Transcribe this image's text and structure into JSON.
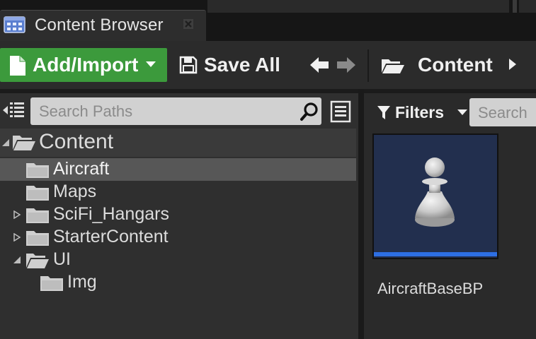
{
  "tab": {
    "title": "Content Browser",
    "icon": "content-browser-icon",
    "close_icon": "close-icon"
  },
  "toolbar": {
    "add_import_label": "Add/Import",
    "save_all_label": "Save All",
    "breadcrumb_root": "Content",
    "accent_green": "#3c9a3c"
  },
  "sources": {
    "search_placeholder": "Search Paths",
    "tree": [
      {
        "label": "Content",
        "expanded": true,
        "level": 0,
        "selected": false
      },
      {
        "label": "Aircraft",
        "expanded": false,
        "level": 1,
        "selected": true
      },
      {
        "label": "Maps",
        "expanded": false,
        "level": 1,
        "selected": false
      },
      {
        "label": "SciFi_Hangars",
        "expanded": false,
        "level": 1,
        "has_children": true,
        "selected": false
      },
      {
        "label": "StarterContent",
        "expanded": false,
        "level": 1,
        "has_children": true,
        "selected": false
      },
      {
        "label": "UI",
        "expanded": true,
        "level": 1,
        "selected": false
      },
      {
        "label": "Img",
        "expanded": false,
        "level": 2,
        "selected": false
      }
    ]
  },
  "assets": {
    "filters_label": "Filters",
    "search_placeholder": "Search",
    "items": [
      {
        "name": "AircraftBaseBP",
        "type_color": "#2d6fe4",
        "thumb_bg": "#222f4e"
      }
    ]
  }
}
